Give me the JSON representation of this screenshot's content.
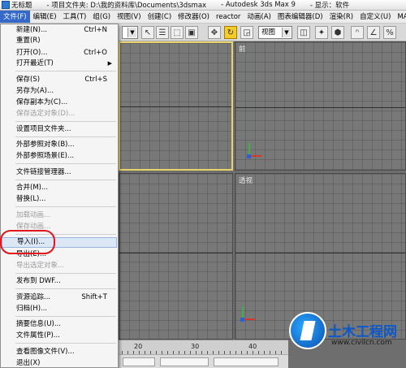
{
  "titlebar": {
    "app_title": "无标题",
    "project_folder": "- 项目文件夹: D:\\我的资料库\\Documents\\3dsmax",
    "app_name": "- Autodesk 3ds Max 9",
    "display": "- 显示：软件"
  },
  "menubar": [
    "文件(F)",
    "编辑(E)",
    "工具(T)",
    "组(G)",
    "视图(V)",
    "创建(C)",
    "修改器(O)",
    "reactor",
    "动画(A)",
    "图表编辑器(D)",
    "渲染(R)",
    "自定义(U)",
    "MAXScript(M)"
  ],
  "toolbar": {
    "view_select": "视图"
  },
  "file_menu": {
    "new": "新建(N)...",
    "new_shortcut": "Ctrl+N",
    "reset": "重置(R)",
    "open": "打开(O)...",
    "open_shortcut": "Ctrl+O",
    "open_recent": "打开最近(T)",
    "save": "保存(S)",
    "save_shortcut": "Ctrl+S",
    "save_as": "另存为(A)...",
    "save_copy_as": "保存副本为(C)...",
    "save_selected": "保存选定对象(D)...",
    "set_project_folder": "设置项目文件夹...",
    "xref_objects": "外部参照对象(B)...",
    "xref_scene": "外部参照场景(E)...",
    "file_link_manager": "文件链接管理器...",
    "merge": "合并(M)...",
    "replace": "替换(L)...",
    "load_animation": "加载动画...",
    "save_animation": "保存动画...",
    "import": "导入(I)...",
    "export": "导出(E)...",
    "export_selected": "导出选定对象...",
    "publish_dwf": "发布到 DWF...",
    "asset_tracking": "资源追踪...",
    "asset_tracking_shortcut": "Shift+T",
    "archive": "归档(H)...",
    "summary_info": "摘要信息(U)...",
    "file_properties": "文件属性(P)...",
    "view_image_file": "查看图像文件(V)...",
    "exit": "退出(X)"
  },
  "viewports": {
    "front_label": "前",
    "perspective_label": "透视"
  },
  "timeline": {
    "ticks": [
      "20",
      "30",
      "40"
    ]
  },
  "watermark": {
    "title": "土木工程网",
    "url": "www.civilcn.com"
  },
  "colors": {
    "menu_active": "#3468c9",
    "viewport_active_border": "#e8d36a",
    "annotation_circle": "#e1161c"
  }
}
